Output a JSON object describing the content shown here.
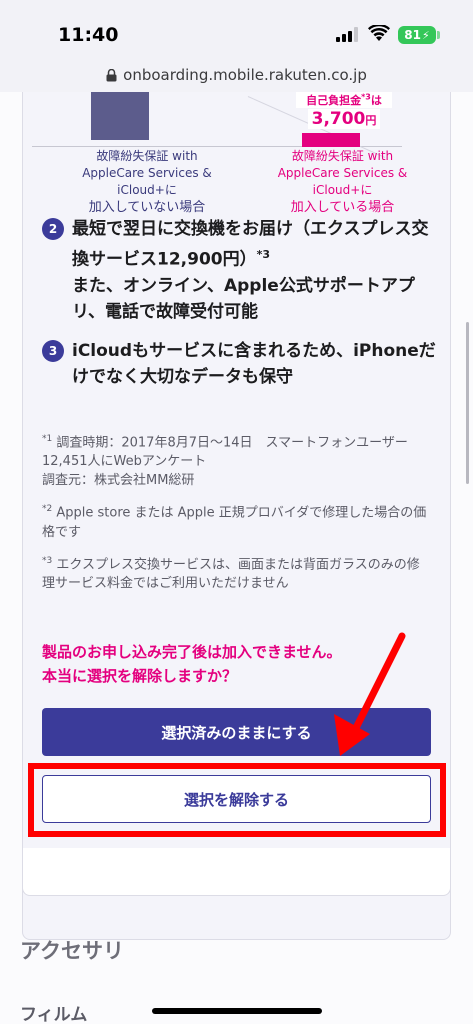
{
  "status_bar": {
    "time": "11:40",
    "battery": "81",
    "icons": [
      "signal-icon",
      "wifi-icon",
      "battery-charging-icon"
    ]
  },
  "browser": {
    "url": "onboarding.mobile.rakuten.co.jp",
    "lock_icon": "lock-icon"
  },
  "comparison": {
    "price_label": "自己負担金",
    "price_label_note": "*3",
    "price_label_suffix": "は",
    "price_value": "3,700",
    "price_unit": "円",
    "left_caption_line1": "故障紛失保証 with",
    "left_caption_line2": "AppleCare Services & iCloud+に",
    "left_caption_line3": "加入していない場合",
    "right_caption_line1": "故障紛失保証 with",
    "right_caption_line2": "AppleCare Services & iCloud+に",
    "right_caption_line3": "加入している場合",
    "colors": {
      "not_enrolled": "#5c5c8c",
      "enrolled": "#e4007f"
    }
  },
  "points": [
    {
      "number": "2",
      "text_a": "最短で翌日に交換機をお届け（エクスプレス交換サービス12,900円）",
      "note": "*3",
      "text_b": "また、オンライン、Apple公式サポートアプリ、電話で故障受付可能"
    },
    {
      "number": "3",
      "text_a": "iCloudもサービスに含まれるため、iPhoneだけでなく大切なデータも保守"
    }
  ],
  "notes": [
    {
      "mark": "*1",
      "text": " 調査時期：2017年8月7日〜14日　スマートフォンユーザー12,451人にWebアンケート"
    },
    {
      "extra": "調査元：株式会社MM総研"
    },
    {
      "mark": "*2",
      "text": " Apple store または Apple 正規プロバイダで修理した場合の価格です"
    },
    {
      "mark": "*3",
      "text": " エクスプレス交換サービスは、画面または背面ガラスのみの修理サービス料金ではご利用いただけません"
    }
  ],
  "warning": {
    "line1": "製品のお申し込み完了後は加入できません。",
    "line2": "本当に選択を解除しますか？"
  },
  "buttons": {
    "keep_label": "選択済みのままにする",
    "remove_label": "選択を解除する"
  },
  "accent_colors": {
    "primary": "#3b3b9a",
    "pink": "#e4007f",
    "annotation_red": "#ff0000"
  },
  "section": {
    "title": "アクセサリ",
    "subtitle": "フィルム"
  }
}
